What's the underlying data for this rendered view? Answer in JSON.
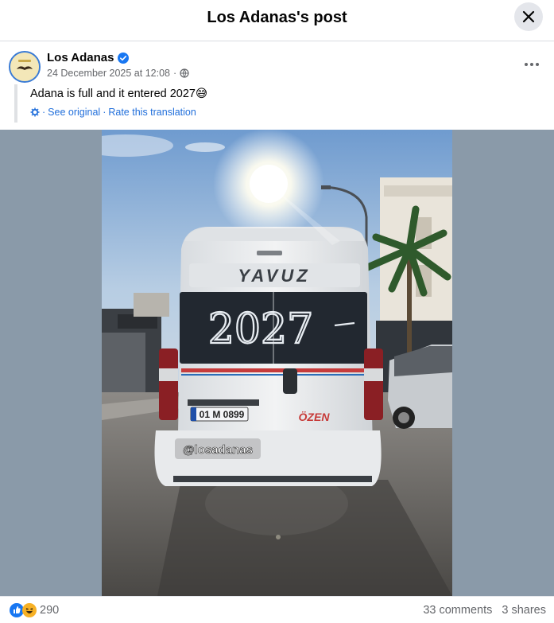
{
  "modal": {
    "title": "Los Adanas's post"
  },
  "post": {
    "author": "Los Adanas",
    "timestamp": "24 December 2025 at 12:08",
    "separator": "·",
    "text": "Adana is full and it entered 2027😅",
    "translation": {
      "see_original": "See original",
      "rate": "Rate this translation",
      "dot": "·"
    }
  },
  "photo": {
    "rear_window_text": "2027",
    "brand_text": "YAVUZ",
    "plate": "01 M 0899",
    "side_brand": "ÖZEN",
    "watermark": "@losadanas"
  },
  "engagement": {
    "reaction_count": "290",
    "comments": "33 comments",
    "shares": "3 shares"
  },
  "colors": {
    "accent": "#216fdb",
    "verified": "#1877f2",
    "stage_bg": "#8a9aa9"
  },
  "icons": [
    "close-icon",
    "verified-badge-icon",
    "globe-icon",
    "more-options-icon",
    "gear-icon",
    "like-reaction-icon",
    "haha-reaction-icon"
  ]
}
